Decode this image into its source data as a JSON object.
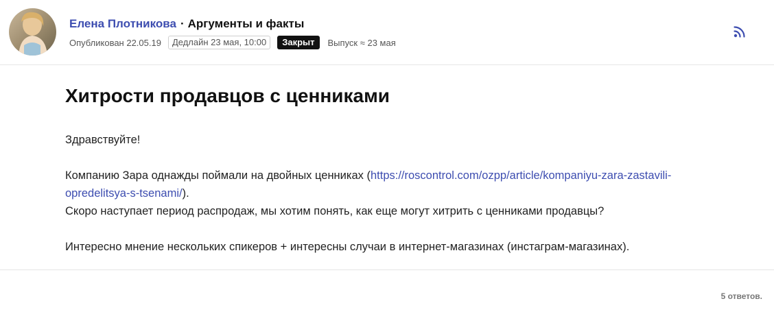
{
  "header": {
    "author": "Елена Плотникова",
    "separator": "·",
    "outlet": "Аргументы и факты",
    "published": "Опубликован 22.05.19",
    "deadline": "Дедлайн 23 мая, 10:00",
    "status": "Закрыт",
    "release": "Выпуск ≈ 23 мая",
    "rss_icon": "rss-icon"
  },
  "post": {
    "title": "Хитрости продавцов с ценниками",
    "greeting": "Здравствуйте!",
    "p1_before": "Компанию Зара однажды поймали на двойных ценниках (",
    "p1_link": "https://roscontrol.com/ozpp/article/kompaniyu-zara-zastavili-opredelitsya-s-tsenami/",
    "p1_after": ").",
    "p2": "Скоро наступает период распродаж, мы хотим понять, как еще могут хитрить с ценниками продавцы?",
    "p3": "Интересно мнение нескольких спикеров + интересны случаи в интернет-магазинах (инстаграм-магазинах)."
  },
  "footer": {
    "answers": "5 ответов."
  },
  "colors": {
    "link": "#3d4db0",
    "badge_bg": "#111111",
    "divider": "#e6e6e6"
  }
}
